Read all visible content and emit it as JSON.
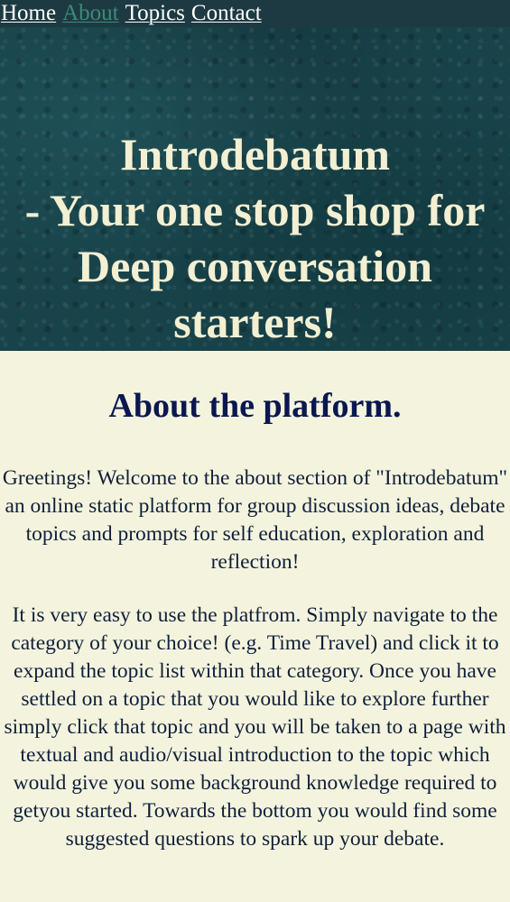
{
  "nav": {
    "items": [
      {
        "label": "Home"
      },
      {
        "label": "About"
      },
      {
        "label": "Topics"
      },
      {
        "label": "Contact"
      }
    ],
    "active": "About"
  },
  "hero": {
    "line1": "Introdebatum",
    "line2": "- Your one stop shop for",
    "line3": "Deep conversation",
    "line4": "starters!"
  },
  "about": {
    "heading": "About the platform.",
    "paragraphs": [
      "Greetings! Welcome to the about section of \"Introdebatum\" an online static platform for group discussion ideas, debate topics and prompts for self education, exploration and reflection!",
      "It is very easy to use the platfrom. Simply navigate to the category of your choice! (e.g. Time Travel) and click it to expand the topic list within that category. Once you have settled on a topic that you would like to explore further simply click that topic and you will be taken to a page with textual and audio/visual introduction to the topic which would give you some background knowledge required to getyou started. Towards the bottom you would find some suggested questions to spark up your debate."
    ]
  },
  "colors": {
    "nav_bg": "#1d3a42",
    "nav_active": "#3f8a79",
    "hero_bg": "#18434a",
    "hero_text": "#f3efd2",
    "page_bg": "#f4f4de",
    "heading": "#0b1750"
  }
}
